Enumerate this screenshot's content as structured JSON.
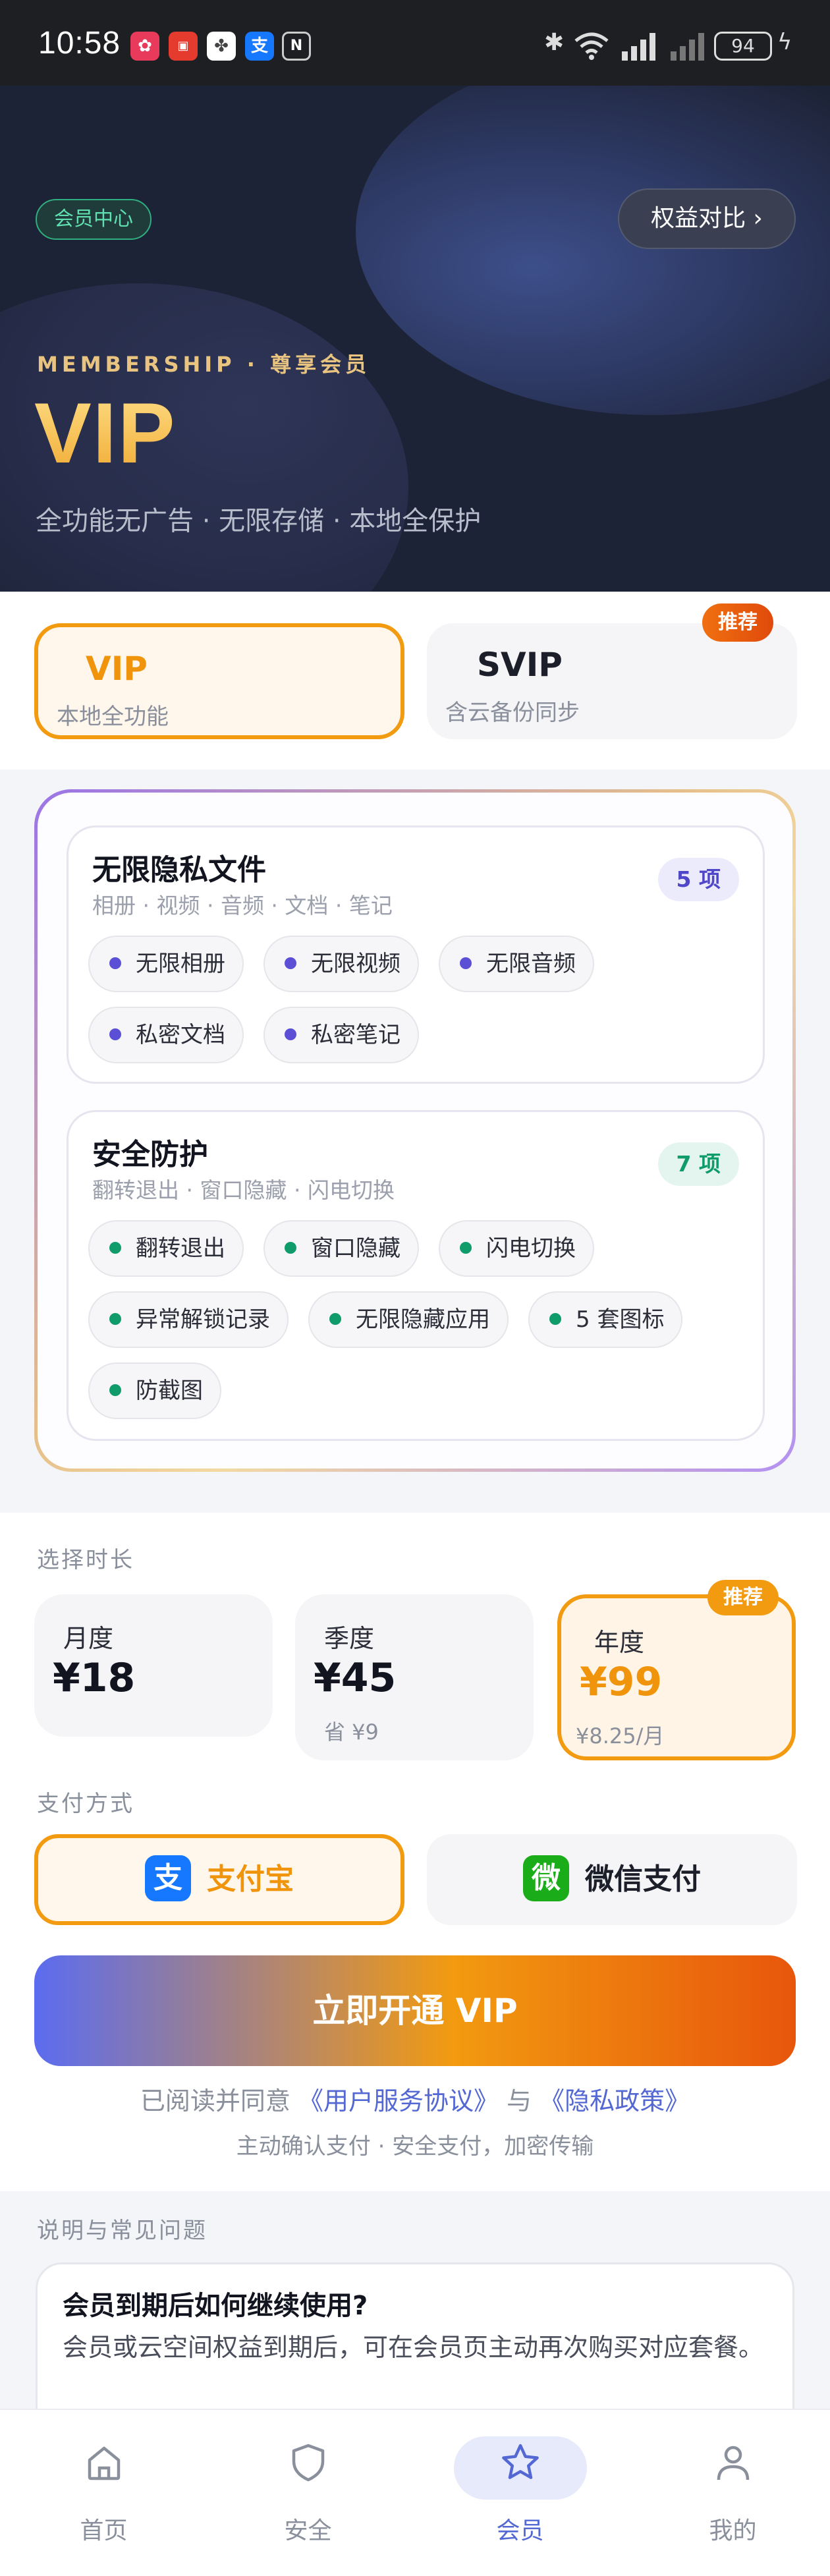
{
  "status_bar": {
    "time": "10:58",
    "battery": "94"
  },
  "hero": {
    "tag": "会员中心",
    "compare_button": "权益对比 ›",
    "kicker": "MEMBERSHIP · 尊享会员",
    "title": "VIP",
    "subtitle": "全功能无广告 · 无限存储 · 本地全保护"
  },
  "plans": [
    {
      "name": "VIP",
      "desc": "本地全功能"
    },
    {
      "name": "SVIP",
      "desc": "含云备份同步",
      "badge": "推荐"
    }
  ],
  "features": [
    {
      "title": "无限隐私文件",
      "sub": "相册 · 视频 · 音频 · 文档 · 笔记",
      "count": "5 项",
      "chips": [
        "无限相册",
        "无限视频",
        "无限音频",
        "私密文档",
        "私密笔记"
      ]
    },
    {
      "title": "安全防护",
      "sub": "翻转退出 · 窗口隐藏 · 闪电切换",
      "count": "7 项",
      "chips": [
        "翻转退出",
        "窗口隐藏",
        "闪电切换",
        "异常解锁记录",
        "无限隐藏应用",
        "5 套图标",
        "防截图"
      ]
    }
  ],
  "duration": {
    "label": "选择时长",
    "options": [
      {
        "name": "月度",
        "price": "¥18",
        "sub": ""
      },
      {
        "name": "季度",
        "price": "¥45",
        "sub": "省 ¥9"
      },
      {
        "name": "年度",
        "price": "¥99",
        "sub": "¥8.25/月",
        "badge": "推荐"
      }
    ]
  },
  "payment": {
    "label": "支付方式",
    "alipay": {
      "icon": "支",
      "label": "支付宝"
    },
    "wechat": {
      "icon": "微",
      "label": "微信支付"
    }
  },
  "cta": {
    "label": "立即开通 VIP"
  },
  "agreement": {
    "prefix": "已阅读并同意",
    "terms": "《用户服务协议》",
    "and": "与",
    "privacy": "《隐私政策》"
  },
  "secure_note": "主动确认支付 · 安全支付，加密传输",
  "faq": {
    "label": "说明与常见问题",
    "items": [
      {
        "q": "会员到期后如何继续使用?",
        "a": "会员或云空间权益到期后，可在会员页主动再次购买对应套餐。"
      }
    ]
  },
  "tabbar": [
    {
      "label": "首页",
      "icon": "home-icon"
    },
    {
      "label": "安全",
      "icon": "shield-icon"
    },
    {
      "label": "会员",
      "icon": "star-icon"
    },
    {
      "label": "我的",
      "icon": "person-icon"
    }
  ],
  "colors": {
    "accent_orange": "#f29a10",
    "accent_blue": "#5468d4",
    "hero_bg": "#1d2336",
    "privacy_dot": "#5b4fd6",
    "security_dot": "#0f9b6a"
  }
}
